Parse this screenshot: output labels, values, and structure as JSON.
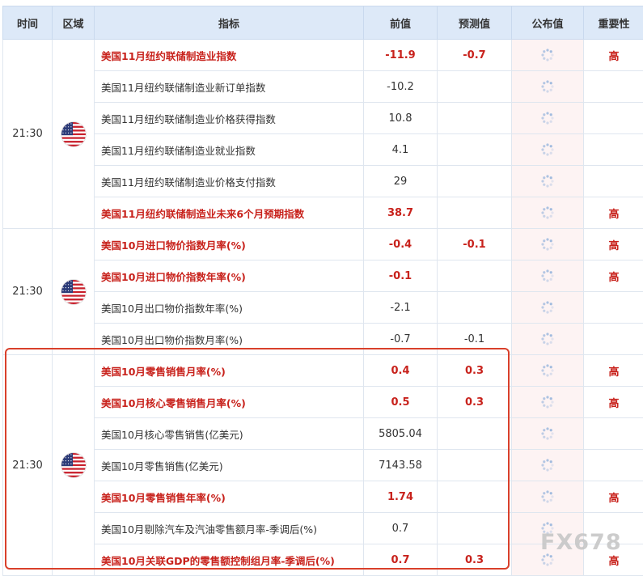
{
  "headers": {
    "time": "时间",
    "region": "区域",
    "indicator": "指标",
    "previous": "前值",
    "forecast": "预测值",
    "published": "公布值",
    "importance": "重要性"
  },
  "groups": [
    {
      "time": "21:30",
      "region_icon": "us-flag-icon",
      "rows": [
        {
          "indicator": "美国11月纽约联储制造业指数",
          "previous": "-11.9",
          "forecast": "-0.7",
          "importance": "高",
          "highlight": true
        },
        {
          "indicator": "美国11月纽约联储制造业新订单指数",
          "previous": "-10.2",
          "forecast": "",
          "importance": "",
          "highlight": false
        },
        {
          "indicator": "美国11月纽约联储制造业价格获得指数",
          "previous": "10.8",
          "forecast": "",
          "importance": "",
          "highlight": false
        },
        {
          "indicator": "美国11月纽约联储制造业就业指数",
          "previous": "4.1",
          "forecast": "",
          "importance": "",
          "highlight": false
        },
        {
          "indicator": "美国11月纽约联储制造业价格支付指数",
          "previous": "29",
          "forecast": "",
          "importance": "",
          "highlight": false
        },
        {
          "indicator": "美国11月纽约联储制造业未来6个月预期指数",
          "previous": "38.7",
          "forecast": "",
          "importance": "高",
          "highlight": true
        }
      ]
    },
    {
      "time": "21:30",
      "region_icon": "us-flag-icon",
      "rows": [
        {
          "indicator": "美国10月进口物价指数月率(%)",
          "previous": "-0.4",
          "forecast": "-0.1",
          "importance": "高",
          "highlight": true
        },
        {
          "indicator": "美国10月进口物价指数年率(%)",
          "previous": "-0.1",
          "forecast": "",
          "importance": "高",
          "highlight": true
        },
        {
          "indicator": "美国10月出口物价指数年率(%)",
          "previous": "-2.1",
          "forecast": "",
          "importance": "",
          "highlight": false
        },
        {
          "indicator": "美国10月出口物价指数月率(%)",
          "previous": "-0.7",
          "forecast": "-0.1",
          "importance": "",
          "highlight": false
        }
      ]
    },
    {
      "time": "21:30",
      "region_icon": "us-flag-icon",
      "rows": [
        {
          "indicator": "美国10月零售销售月率(%)",
          "previous": "0.4",
          "forecast": "0.3",
          "importance": "高",
          "highlight": true
        },
        {
          "indicator": "美国10月核心零售销售月率(%)",
          "previous": "0.5",
          "forecast": "0.3",
          "importance": "高",
          "highlight": true
        },
        {
          "indicator": "美国10月核心零售销售(亿美元)",
          "previous": "5805.04",
          "forecast": "",
          "importance": "",
          "highlight": false
        },
        {
          "indicator": "美国10月零售销售(亿美元)",
          "previous": "7143.58",
          "forecast": "",
          "importance": "",
          "highlight": false
        },
        {
          "indicator": "美国10月零售销售年率(%)",
          "previous": "1.74",
          "forecast": "",
          "importance": "高",
          "highlight": true
        },
        {
          "indicator": "美国10月剔除汽车及汽油零售额月率-季调后(%)",
          "previous": "0.7",
          "forecast": "",
          "importance": "",
          "highlight": false
        },
        {
          "indicator": "美国10月关联GDP的零售额控制组月率-季调后(%)",
          "previous": "0.7",
          "forecast": "0.3",
          "importance": "高",
          "highlight": true
        }
      ]
    }
  ],
  "published_icon": "loading-spinner-icon",
  "watermark": "FX678",
  "colors": {
    "header_bg": "#dde9f8",
    "highlight_text": "#c8221c",
    "published_bg": "#fdf3f3",
    "box_border": "#d9402b"
  }
}
